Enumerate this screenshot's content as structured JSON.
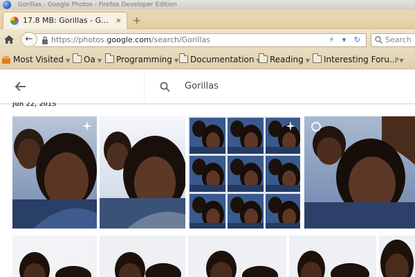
{
  "window": {
    "title": "Gorillas - Google Photos - Firefox Developer Edition"
  },
  "tab": {
    "title": "17.8 MB: Gorillas - G...",
    "close": "×",
    "new_tab": "+"
  },
  "nav": {
    "back": "←",
    "url_prefix": "https://photos.",
    "url_host": "google.com",
    "url_path": "/search/Gorillas",
    "url_icons": "⚡ ▾ ↻",
    "search_placeholder": "Search"
  },
  "bookmarks": {
    "items": [
      {
        "label": "Most Visited",
        "icon": "most-visited-icon"
      },
      {
        "label": "Oa",
        "icon": "folder-icon"
      },
      {
        "label": "Programming",
        "icon": "folder-icon"
      },
      {
        "label": "Documentation",
        "icon": "folder-icon"
      },
      {
        "label": "Reading",
        "icon": "folder-icon"
      },
      {
        "label": "Interesting Foru...",
        "icon": "folder-icon"
      }
    ],
    "dropdown_arrow": "▼",
    "more": "»"
  },
  "photos_app": {
    "search_query": "Gorillas",
    "date_heading": "Jun 22, 2015"
  },
  "colors": {
    "tab_strip": "#e6d5ad",
    "accent_blue": "#3f6fb0",
    "photo_sky": "#8ea4c6"
  }
}
